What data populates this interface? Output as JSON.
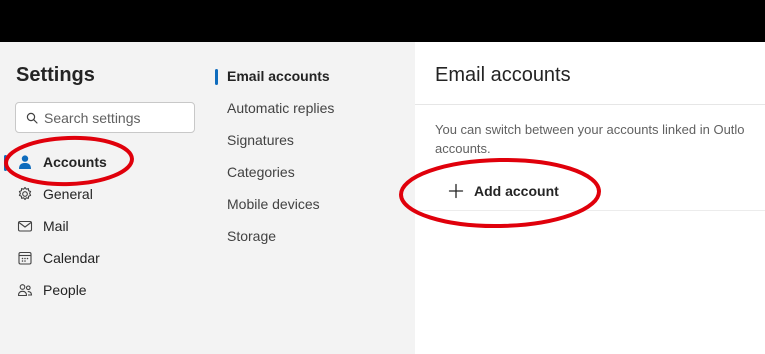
{
  "settings": {
    "title": "Settings",
    "search_placeholder": "Search settings",
    "nav": [
      {
        "label": "Accounts",
        "icon": "person-icon",
        "active": true
      },
      {
        "label": "General",
        "icon": "gear-icon",
        "active": false
      },
      {
        "label": "Mail",
        "icon": "mail-icon",
        "active": false
      },
      {
        "label": "Calendar",
        "icon": "calendar-icon",
        "active": false
      },
      {
        "label": "People",
        "icon": "people-icon",
        "active": false
      }
    ]
  },
  "accounts_menu": {
    "items": [
      {
        "label": "Email accounts",
        "active": true
      },
      {
        "label": "Automatic replies",
        "active": false
      },
      {
        "label": "Signatures",
        "active": false
      },
      {
        "label": "Categories",
        "active": false
      },
      {
        "label": "Mobile devices",
        "active": false
      },
      {
        "label": "Storage",
        "active": false
      }
    ]
  },
  "main": {
    "title": "Email accounts",
    "description_line1": "You can switch between your accounts linked in Outlo",
    "description_line2": "accounts.",
    "add_account_label": "Add account"
  },
  "colors": {
    "accent": "#0f6cbd",
    "annotation_red": "#e0000b",
    "panel_bg": "#f3f3f3"
  }
}
